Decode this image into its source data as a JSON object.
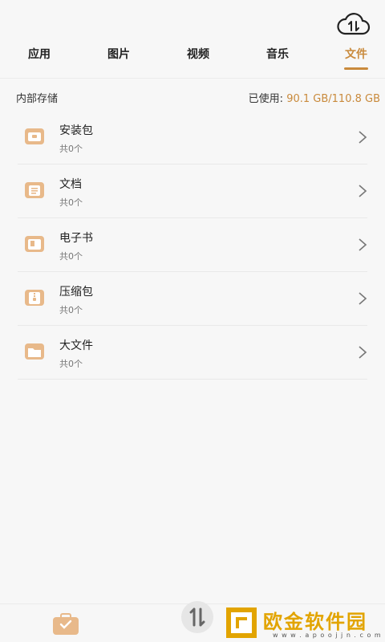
{
  "tabs": [
    {
      "label": "应用"
    },
    {
      "label": "图片"
    },
    {
      "label": "视频"
    },
    {
      "label": "音乐"
    },
    {
      "label": "文件"
    }
  ],
  "storage": {
    "label": "内部存储",
    "usage_prefix": "已使用:",
    "usage_value": "90.1 GB/110.8 GB"
  },
  "categories": [
    {
      "title": "安装包",
      "count": "共0个",
      "icon": "package-icon"
    },
    {
      "title": "文档",
      "count": "共0个",
      "icon": "document-icon"
    },
    {
      "title": "电子书",
      "count": "共0个",
      "icon": "ebook-icon"
    },
    {
      "title": "压缩包",
      "count": "共0个",
      "icon": "archive-icon"
    },
    {
      "title": "大文件",
      "count": "共0个",
      "icon": "folder-icon"
    }
  ],
  "watermark": {
    "text": "欧金软件园",
    "url": "w w w . a p o o j j n . c o m"
  },
  "colors": {
    "accent": "#c98a3c",
    "icon_fill": "#e8b98a",
    "background": "#f7f7f7"
  }
}
